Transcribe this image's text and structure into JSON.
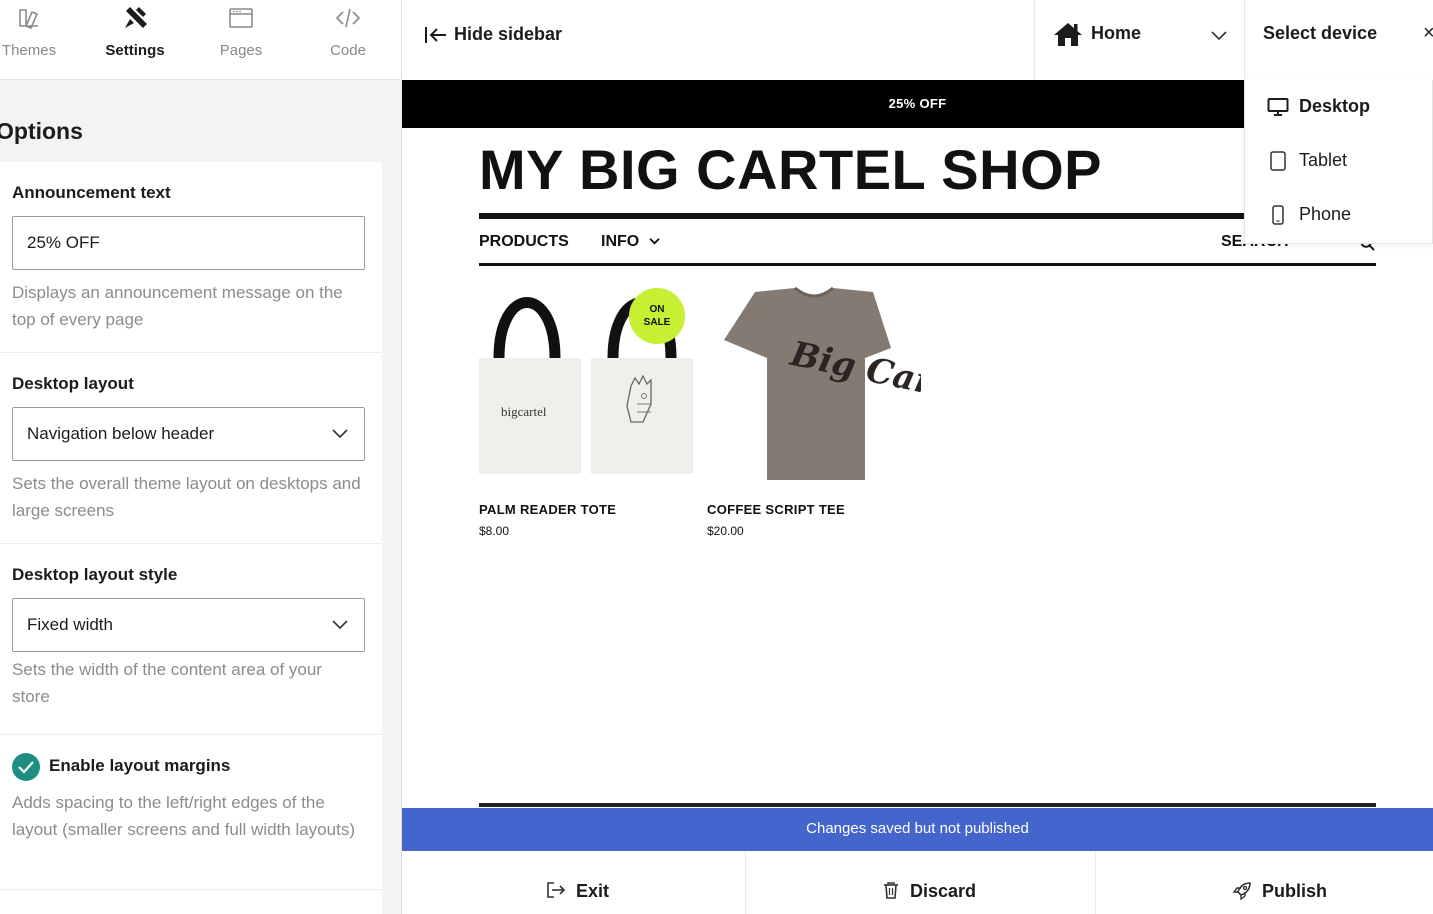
{
  "sidebar": {
    "tabs": [
      {
        "label": "Themes",
        "icon": "themes-icon"
      },
      {
        "label": "Settings",
        "icon": "settings-icon",
        "active": true
      },
      {
        "label": "Pages",
        "icon": "pages-icon"
      },
      {
        "label": "Code",
        "icon": "code-icon"
      }
    ],
    "options_title": "Options",
    "announcement": {
      "label": "Announcement text",
      "value": "25% OFF",
      "help": "Displays an announcement message on the top of every page"
    },
    "desktop_layout": {
      "label": "Desktop layout",
      "value": "Navigation below header",
      "help": "Sets the overall theme layout on desktops and large screens"
    },
    "desktop_layout_style": {
      "label": "Desktop layout style",
      "value": "Fixed width",
      "help": "Sets the width of the content area of your store"
    },
    "layout_margins": {
      "label": "Enable layout margins",
      "checked": true,
      "help": "Adds spacing to the left/right edges of the layout (smaller screens and full width layouts)"
    }
  },
  "topbar": {
    "hide_sidebar": "Hide sidebar",
    "page": "Home",
    "device_label": "Select device",
    "close": "×"
  },
  "device_menu": {
    "items": [
      {
        "label": "Desktop",
        "icon": "desktop-icon",
        "selected": true
      },
      {
        "label": "Tablet",
        "icon": "tablet-icon"
      },
      {
        "label": "Phone",
        "icon": "phone-icon"
      }
    ]
  },
  "store": {
    "announcement": "25% OFF",
    "title": "MY BIG CARTEL SHOP",
    "nav": {
      "products": "PRODUCTS",
      "info": "INFO",
      "search": "SEARCH"
    },
    "products": [
      {
        "name": "PALM READER TOTE",
        "price": "$8.00",
        "badge": [
          "ON",
          "SALE"
        ],
        "tote_brand": "bigcartel"
      },
      {
        "name": "COFFEE SCRIPT TEE",
        "price": "$20.00",
        "print": "Big Cartel"
      }
    ]
  },
  "status": "Changes saved but not published",
  "actions": {
    "exit": "Exit",
    "discard": "Discard",
    "publish": "Publish"
  },
  "colors": {
    "accent_check": "#1e8e82",
    "status_bar": "#4466cc",
    "sale_badge": "#c6f031"
  }
}
